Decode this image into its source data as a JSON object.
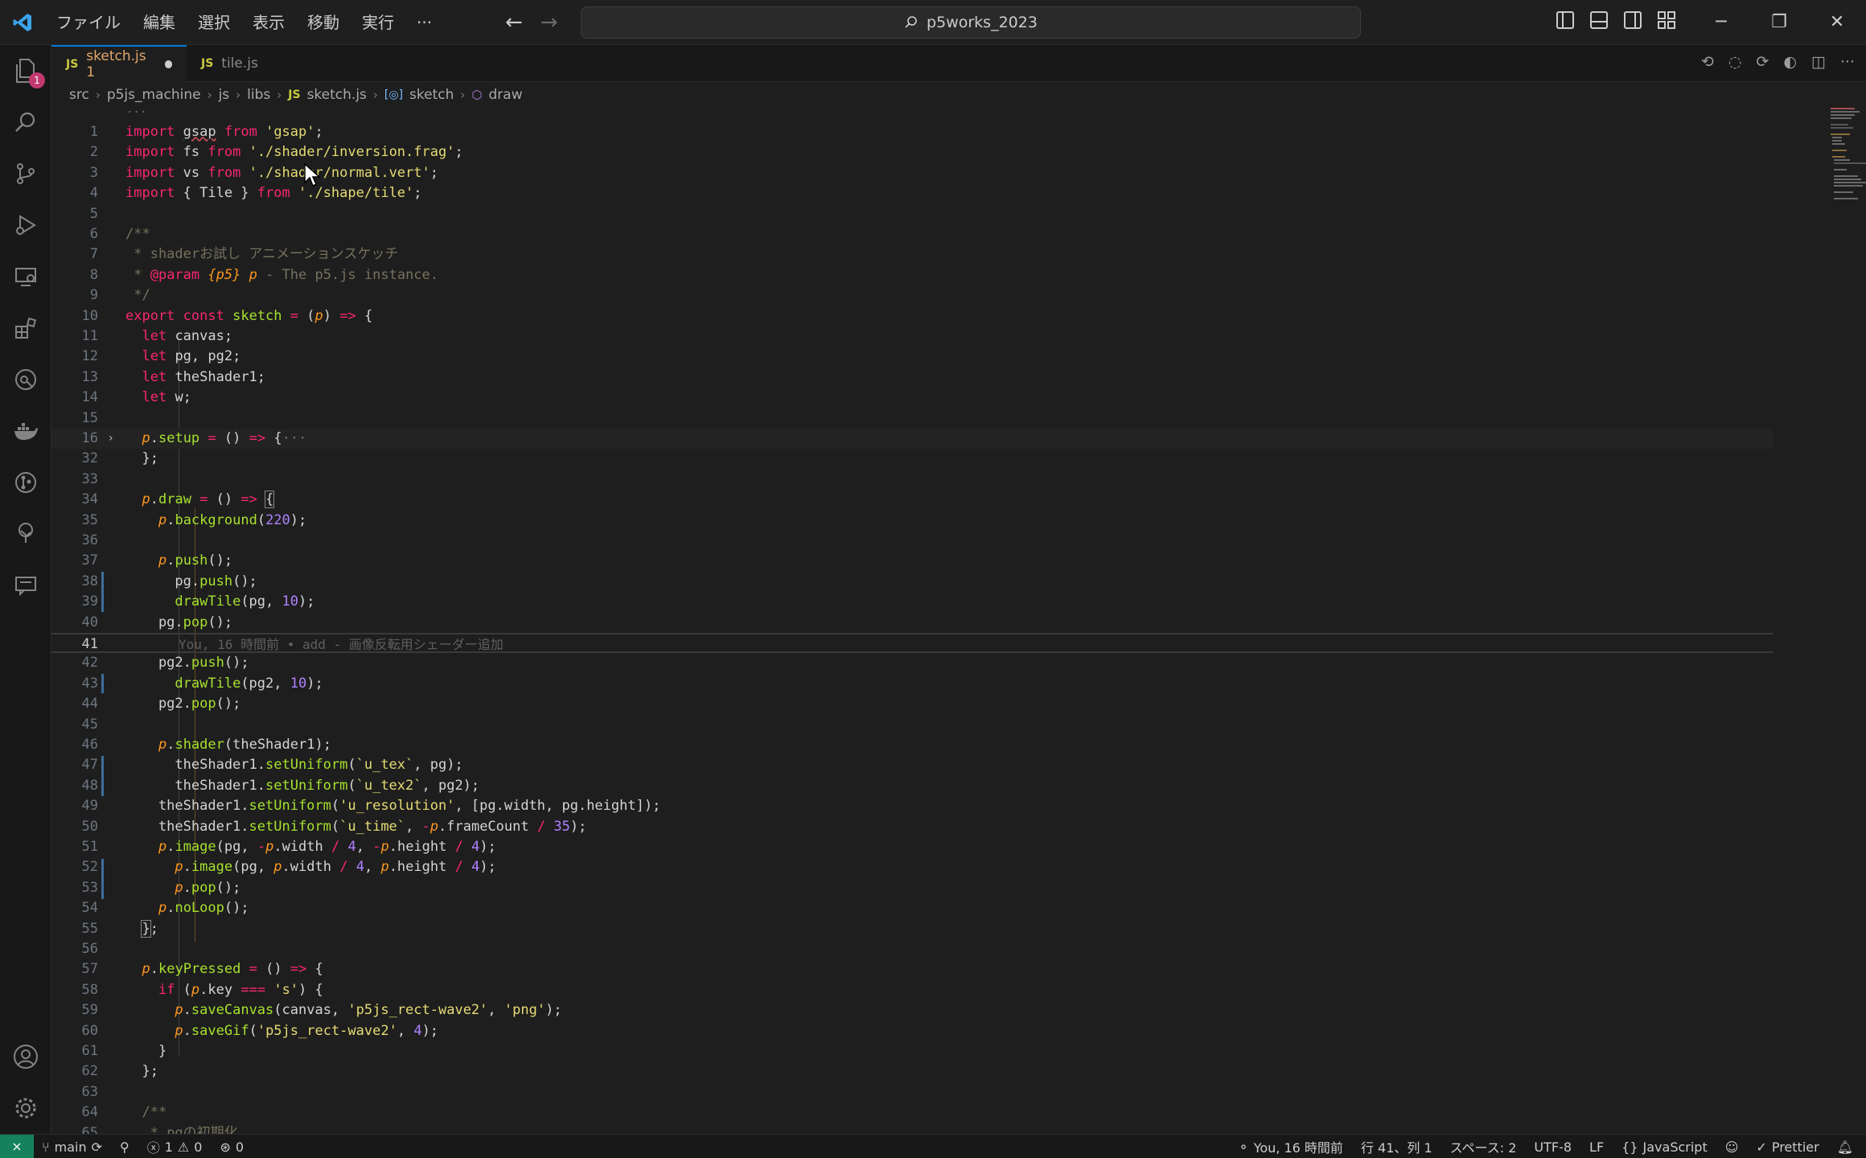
{
  "titlebar": {
    "menu": [
      "ファイル",
      "編集",
      "選択",
      "表示",
      "移動",
      "実行",
      "···"
    ],
    "search_text": "p5works_2023"
  },
  "activity_bar": {
    "explorer_badge": "1",
    "icons": [
      "explorer-icon",
      "search-icon",
      "source-control-icon",
      "run-debug-icon",
      "remote-explorer-icon",
      "extensions-icon",
      "git-graph-icon",
      "docker-icon",
      "gitlens-icon",
      "tree-icon",
      "comments-icon",
      "account-icon",
      "settings-gear-icon"
    ]
  },
  "tabs": [
    {
      "label": "sketch.js",
      "suffix": "1",
      "active": true,
      "dirty": true,
      "lang": "JS"
    },
    {
      "label": "tile.js",
      "active": false,
      "lang": "JS"
    }
  ],
  "breadcrumbs": [
    "src",
    "p5js_machine",
    "js",
    "libs",
    "sketch.js",
    "sketch",
    "draw"
  ],
  "breadcrumb_lang": "JS",
  "editor": {
    "folded_marker": "···",
    "blame_text": "You, 16 時間前 • add - 画像反転用シェーダー追加"
  },
  "statusbar": {
    "branch": "main",
    "errors": "1",
    "warnings": "0",
    "ports": "0",
    "blame": "You, 16 時間前",
    "position": "行 41、列 1",
    "spaces": "スペース: 2",
    "encoding": "UTF-8",
    "eol": "LF",
    "language": "JavaScript",
    "formatter": "Prettier"
  },
  "colors": {
    "accent": "#0078d4",
    "remote": "#16825d",
    "badge": "#c2396f"
  }
}
